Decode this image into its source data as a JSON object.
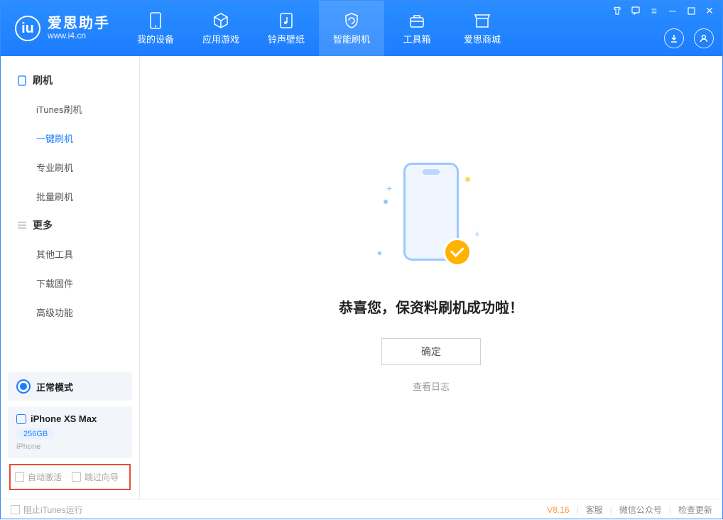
{
  "app": {
    "name_cn": "爱思助手",
    "url": "www.i4.cn"
  },
  "tabs": [
    {
      "label": "我的设备"
    },
    {
      "label": "应用游戏"
    },
    {
      "label": "铃声壁纸"
    },
    {
      "label": "智能刷机"
    },
    {
      "label": "工具箱"
    },
    {
      "label": "爱思商城"
    }
  ],
  "sidebar": {
    "group_flash": "刷机",
    "items_flash": [
      "iTunes刷机",
      "一键刷机",
      "专业刷机",
      "批量刷机"
    ],
    "group_more": "更多",
    "items_more": [
      "其他工具",
      "下载固件",
      "高级功能"
    ]
  },
  "device": {
    "mode": "正常模式",
    "name": "iPhone XS Max",
    "storage": "256GB",
    "type": "iPhone"
  },
  "options": {
    "auto_activate": "自动激活",
    "skip_guide": "跳过向导"
  },
  "main": {
    "success": "恭喜您，保资料刷机成功啦！",
    "confirm": "确定",
    "view_log": "查看日志"
  },
  "footer": {
    "block_itunes": "阻止iTunes运行",
    "version": "V8.16",
    "support": "客服",
    "wechat": "微信公众号",
    "update": "检查更新"
  }
}
